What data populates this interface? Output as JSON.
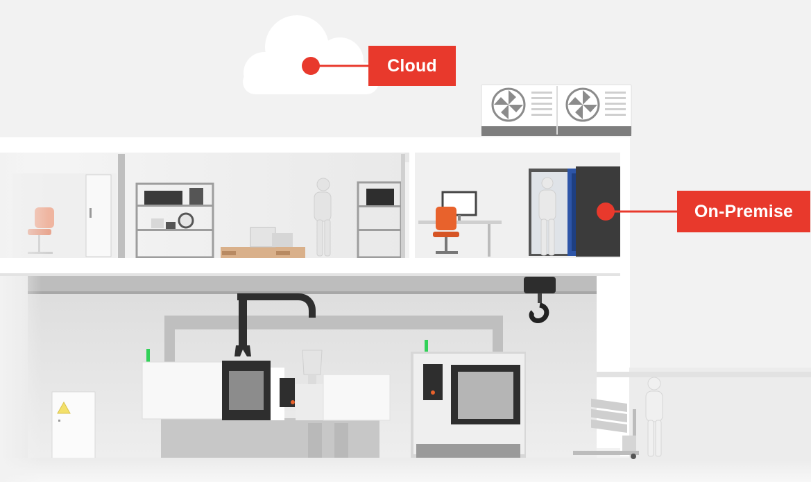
{
  "labels": {
    "cloud": "Cloud",
    "on_premise": "On-Premise"
  },
  "colors": {
    "accent": "#e8392c",
    "background": "#f2f2f2",
    "wall": "#ffffff",
    "cabinet": "#3b3b3b",
    "server_blue": "#2d55a8",
    "status_light": "#31d158",
    "chair_orange": "#e8622c",
    "pallet_wood": "#d9b08a",
    "warning_yellow": "#f3e06a"
  },
  "icons": {
    "cloud": "cloud-icon",
    "fan": "fan-icon",
    "hook": "crane-hook-icon",
    "warning": "warning-triangle-icon"
  }
}
